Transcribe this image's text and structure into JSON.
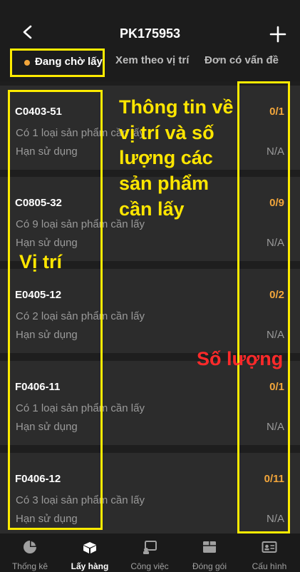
{
  "header": {
    "title": "PK175953"
  },
  "tabs": [
    {
      "label": "Đang chờ lấy",
      "active": true
    },
    {
      "label": "Xem theo vị trí"
    },
    {
      "label": "Đơn có vấn đề"
    }
  ],
  "items": [
    {
      "code": "C0403-51",
      "count_text": "Có 1 loại sản phẩm cần lấy",
      "expiry_label": "Hạn sử dụng",
      "qty": "0/1",
      "expiry": "N/A"
    },
    {
      "code": "C0805-32",
      "count_text": "Có 9 loại sản phẩm cần lấy",
      "expiry_label": "Hạn sử dụng",
      "qty": "0/9",
      "expiry": "N/A"
    },
    {
      "code": "E0405-12",
      "count_text": "Có 2 loại sản phẩm cần lấy",
      "expiry_label": "Hạn sử dụng",
      "qty": "0/2",
      "expiry": "N/A"
    },
    {
      "code": "F0406-11",
      "count_text": "Có 1 loại sản phẩm cần lấy",
      "expiry_label": "Hạn sử dụng",
      "qty": "0/1",
      "expiry": "N/A"
    },
    {
      "code": "F0406-12",
      "count_text": "Có 3 loại sản phẩm cần lấy",
      "expiry_label": "Hạn sử dụng",
      "qty": "0/11",
      "expiry": "N/A"
    }
  ],
  "annotations": {
    "info": "Thông tin về vị trí và số lượng các sản phẩm cần lấy",
    "location": "Vị trí",
    "quantity": "Số lượng"
  },
  "bottom_nav": [
    {
      "label": "Thống kê",
      "icon": "pie-chart-icon"
    },
    {
      "label": "Lấy hàng",
      "icon": "boxes-icon",
      "active": true
    },
    {
      "label": "Công việc",
      "icon": "task-icon"
    },
    {
      "label": "Đóng gói",
      "icon": "package-icon"
    },
    {
      "label": "Cấu hình",
      "icon": "id-card-icon"
    }
  ],
  "colors": {
    "accent": "#f3a63b",
    "highlight": "#ffeb00",
    "annotation_red": "#ff2a2a"
  }
}
